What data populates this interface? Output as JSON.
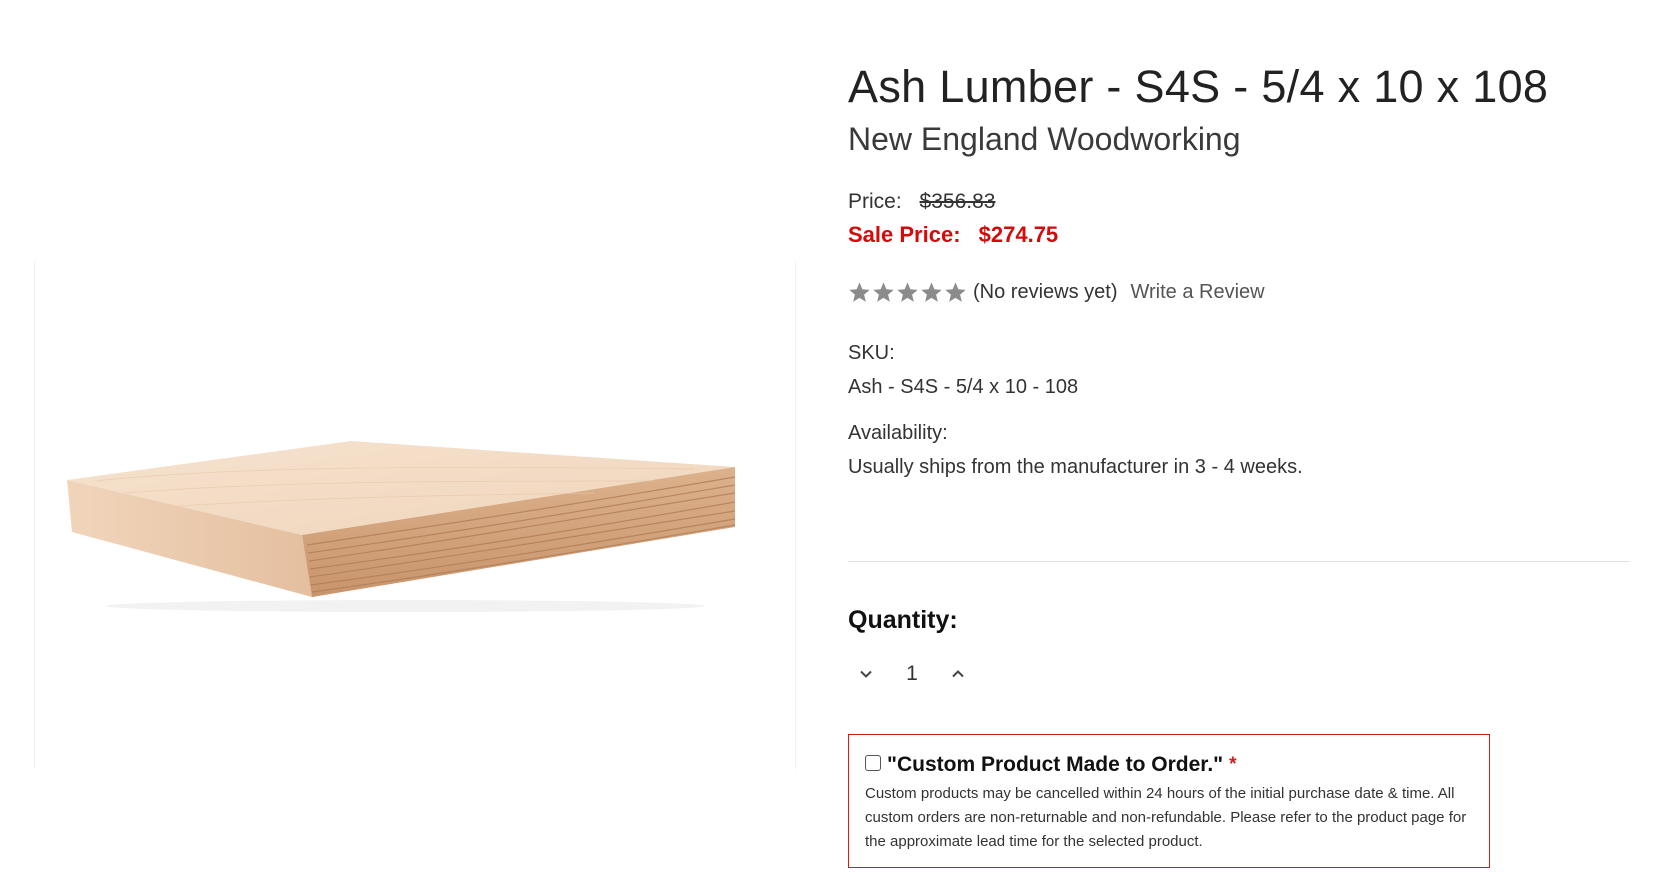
{
  "product": {
    "title": "Ash Lumber - S4S - 5/4 x 10 x 108",
    "brand": "New England Woodworking",
    "price_label": "Price:",
    "price": "$356.83",
    "sale_label": "Sale Price:",
    "sale_price": "$274.75",
    "rating": {
      "stars": 5,
      "filled_stars": 0,
      "reviews_text": "(No reviews yet)",
      "write_review": "Write a Review"
    },
    "sku_label": "SKU:",
    "sku": "Ash - S4S - 5/4 x 10 - 108",
    "availability_label": "Availability:",
    "availability": "Usually ships from the manufacturer in 3 - 4 weeks."
  },
  "quantity": {
    "label": "Quantity:",
    "value": "1"
  },
  "custom_order": {
    "title": "\"Custom Product Made to Order.\"",
    "required_marker": "*",
    "checked": false,
    "text": "Custom products may be cancelled within 24 hours of the initial purchase date & time. All custom orders are non-returnable and non-refundable. Please refer to the product page for the approximate lead time for the selected product."
  },
  "icons": {
    "star": "star-icon",
    "decrease": "chevron-down-icon",
    "increase": "chevron-up-icon"
  },
  "colors": {
    "sale": "#d50a0a",
    "star_empty": "#8c8c8c",
    "custom_border": "#d01c1c"
  }
}
